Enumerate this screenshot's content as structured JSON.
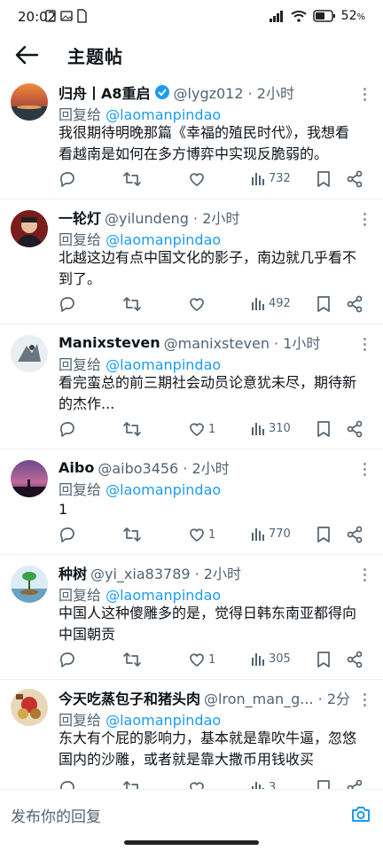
{
  "status_bar": {
    "time": "20:02",
    "battery": "52"
  },
  "header": {
    "title": "主题帖"
  },
  "posts": [
    {
      "name": "归舟丨A8重启",
      "verified": true,
      "handle": "@lygz012 · 2小时",
      "reply_prefix": "回复给 ",
      "reply_to": "@laomanpindao",
      "lines": [
        "我很期待明晚那篇《幸福的殖民时代》，我想看",
        "看越南是如何在多方博弈中实现反脆弱的。"
      ],
      "likes": "",
      "views": "732"
    },
    {
      "name": "一轮灯",
      "verified": false,
      "handle": "@yilundeng · 2小时",
      "reply_prefix": "回复给 ",
      "reply_to": "@laomanpindao",
      "lines": [
        "北越这边有点中国文化的影子，南边就几乎看不",
        "到了。"
      ],
      "likes": "",
      "views": "492"
    },
    {
      "name": "Manixsteven",
      "verified": false,
      "handle": "@manixsteven · 1小时",
      "reply_prefix": "回复给 ",
      "reply_to": "@laomanpindao",
      "lines": [
        "看完蛮总的前三期社会动员论意犹未尽，期待新",
        "的杰作..."
      ],
      "likes": "1",
      "views": "310"
    },
    {
      "name": "Aibo",
      "verified": false,
      "handle": "@aibo3456 · 2小时",
      "reply_prefix": "回复给 ",
      "reply_to": "@laomanpindao",
      "lines": [
        "1"
      ],
      "likes": "1",
      "views": "770"
    },
    {
      "name": "种树",
      "verified": false,
      "handle": "@yi_xia83789 · 2小时",
      "reply_prefix": "回复给 ",
      "reply_to": "@laomanpindao",
      "lines": [
        "中国人这种傻雕多的是，觉得日韩东南亚都得向",
        "中国朝贡"
      ],
      "likes": "1",
      "views": "305"
    },
    {
      "name": "今天吃蒸包子和猪头肉",
      "verified": false,
      "handle": "@lron_man_g... · 2分",
      "reply_prefix": "回复给 ",
      "reply_to": "@laomanpindao",
      "lines": [
        "东大有个屁的影响力，基本就是靠吹牛逼，忽悠",
        "国内的沙雕，或者就是靠大撒币用钱收买"
      ],
      "likes": "",
      "views": "3"
    }
  ],
  "reply_bar": {
    "placeholder": "发布你的回复"
  },
  "colors": {
    "accent": "#1d9bf0",
    "muted": "#536471",
    "text": "#0f1419"
  }
}
